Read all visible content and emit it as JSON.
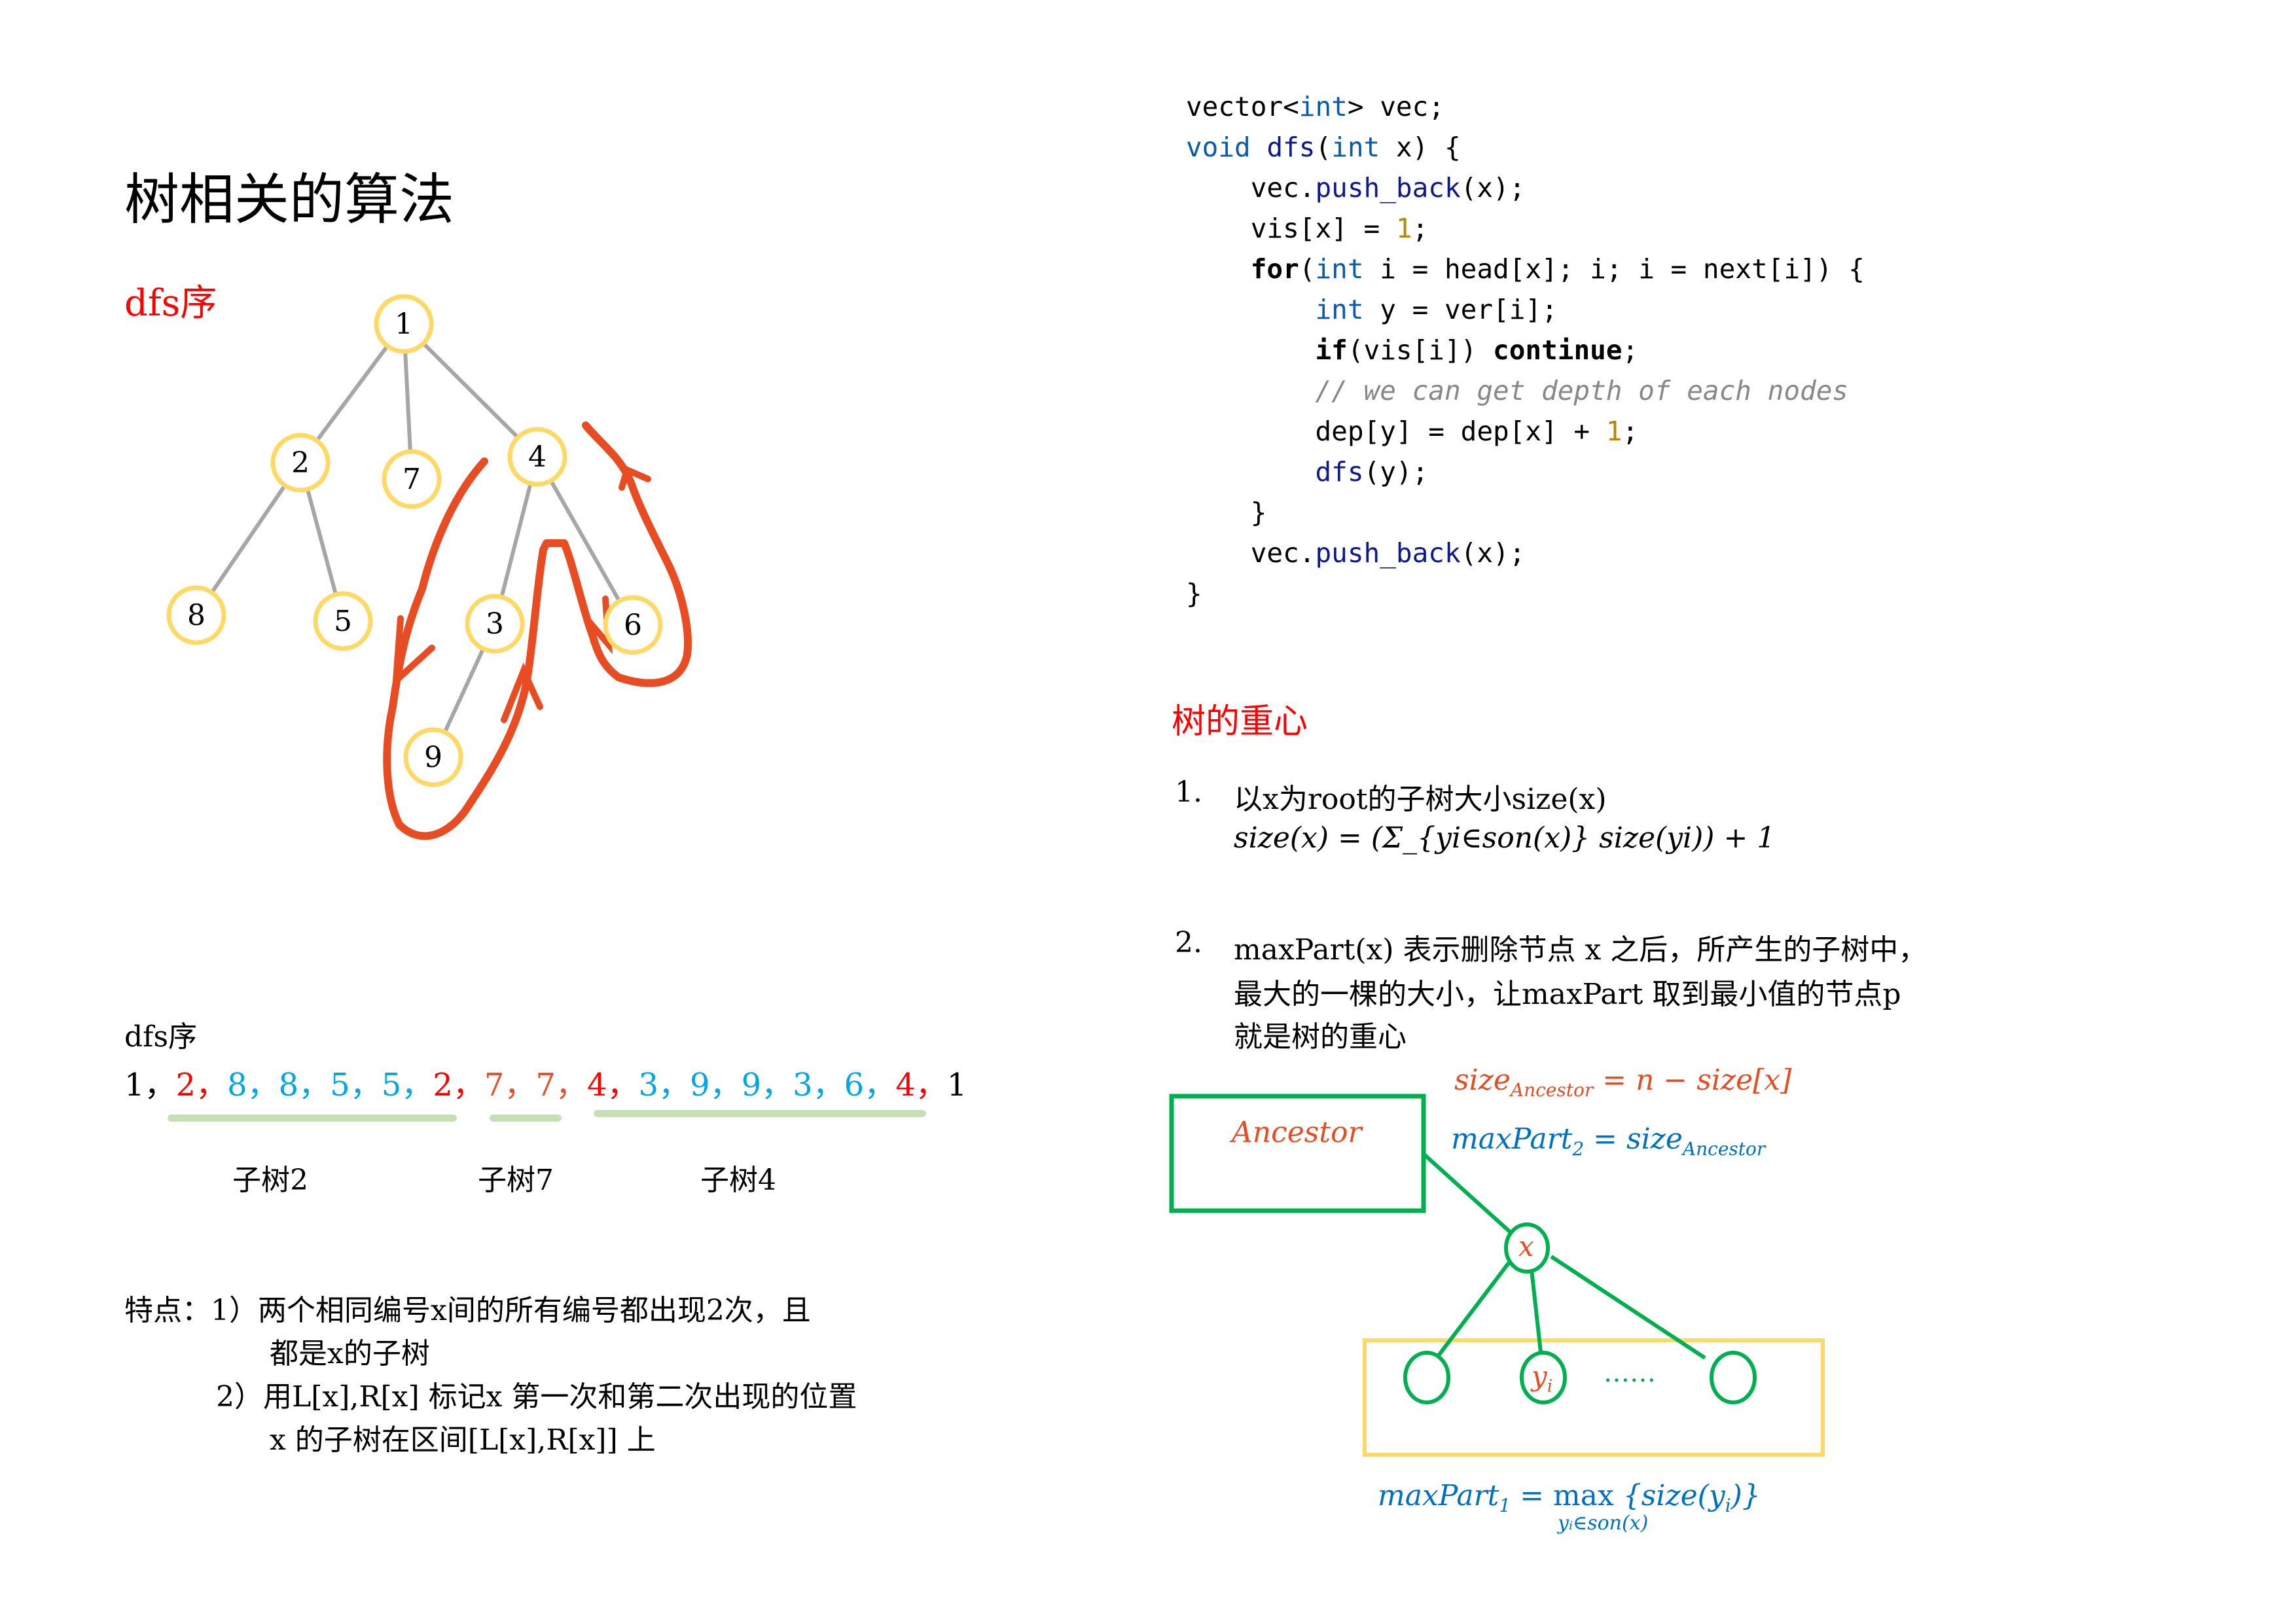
{
  "title": "树相关的算法",
  "dfs_section": {
    "heading": "dfs序",
    "tree": {
      "nodes": [
        {
          "id": "1",
          "label": "1"
        },
        {
          "id": "2",
          "label": "2"
        },
        {
          "id": "7",
          "label": "7"
        },
        {
          "id": "4",
          "label": "4"
        },
        {
          "id": "8",
          "label": "8"
        },
        {
          "id": "5",
          "label": "5"
        },
        {
          "id": "3",
          "label": "3"
        },
        {
          "id": "6",
          "label": "6"
        },
        {
          "id": "9",
          "label": "9"
        }
      ],
      "edges": [
        [
          "1",
          "2"
        ],
        [
          "1",
          "7"
        ],
        [
          "1",
          "4"
        ],
        [
          "2",
          "8"
        ],
        [
          "2",
          "5"
        ],
        [
          "4",
          "3"
        ],
        [
          "4",
          "6"
        ],
        [
          "3",
          "9"
        ]
      ],
      "node_color": "#ffd966",
      "edge_color": "#a6a6a6",
      "annotation_color": "#e84c22"
    },
    "sequence_label": "dfs序",
    "sequence": [
      {
        "v": "1",
        "color": "black"
      },
      {
        "v": "2",
        "color": "red"
      },
      {
        "v": "8",
        "color": "blue"
      },
      {
        "v": "8",
        "color": "blue"
      },
      {
        "v": "5",
        "color": "blue"
      },
      {
        "v": "5",
        "color": "blue"
      },
      {
        "v": "2",
        "color": "red"
      },
      {
        "v": "7",
        "color": "orange"
      },
      {
        "v": "7",
        "color": "orange"
      },
      {
        "v": "4",
        "color": "red"
      },
      {
        "v": "3",
        "color": "blue"
      },
      {
        "v": "9",
        "color": "blue"
      },
      {
        "v": "9",
        "color": "blue"
      },
      {
        "v": "3",
        "color": "blue"
      },
      {
        "v": "6",
        "color": "blue"
      },
      {
        "v": "4",
        "color": "red"
      },
      {
        "v": "1",
        "color": "black"
      }
    ],
    "separator": "，",
    "subtree_labels": [
      "子树2",
      "子树7",
      "子树4"
    ],
    "features": {
      "prefix": "特点：",
      "items": [
        {
          "num": "1）",
          "line1": "两个相同编号x间的所有编号都出现2次，且",
          "line2": "都是x的子树"
        },
        {
          "num": "2）",
          "line1": "用L[x],R[x] 标记x 第一次和第二次出现的位置",
          "line2": "x 的子树在区间[L[x],R[x]] 上"
        }
      ]
    }
  },
  "code": {
    "lines": [
      [
        {
          "t": "vector<",
          "c": ""
        },
        {
          "t": "int",
          "c": "kw"
        },
        {
          "t": "> vec;",
          "c": ""
        }
      ],
      [
        {
          "t": "void",
          "c": "kw"
        },
        {
          "t": " ",
          "c": ""
        },
        {
          "t": "dfs",
          "c": "fn"
        },
        {
          "t": "(",
          "c": ""
        },
        {
          "t": "int",
          "c": "kw"
        },
        {
          "t": " x) {",
          "c": ""
        }
      ],
      [
        {
          "t": "    vec.",
          "c": ""
        },
        {
          "t": "push_back",
          "c": "fn"
        },
        {
          "t": "(x);",
          "c": ""
        }
      ],
      [
        {
          "t": "    vis[x] = ",
          "c": ""
        },
        {
          "t": "1",
          "c": "num"
        },
        {
          "t": ";",
          "c": ""
        }
      ],
      [
        {
          "t": "    ",
          "c": ""
        },
        {
          "t": "for",
          "c": "bold"
        },
        {
          "t": "(",
          "c": ""
        },
        {
          "t": "int",
          "c": "kw"
        },
        {
          "t": " i = head[x]; i; i = next[i]) {",
          "c": ""
        }
      ],
      [
        {
          "t": "        ",
          "c": ""
        },
        {
          "t": "int",
          "c": "kw"
        },
        {
          "t": " y = ver[i];",
          "c": ""
        }
      ],
      [
        {
          "t": "        ",
          "c": ""
        },
        {
          "t": "if",
          "c": "bold"
        },
        {
          "t": "(vis[i]) ",
          "c": ""
        },
        {
          "t": "continue",
          "c": "bold"
        },
        {
          "t": ";",
          "c": ""
        }
      ],
      [
        {
          "t": "        ",
          "c": ""
        },
        {
          "t": "// we can get depth of each nodes",
          "c": "cm"
        }
      ],
      [
        {
          "t": "        dep[y] = dep[x] + ",
          "c": ""
        },
        {
          "t": "1",
          "c": "num"
        },
        {
          "t": ";",
          "c": ""
        }
      ],
      [
        {
          "t": "        ",
          "c": ""
        },
        {
          "t": "dfs",
          "c": "fn"
        },
        {
          "t": "(y);",
          "c": ""
        }
      ],
      [
        {
          "t": "    }",
          "c": ""
        }
      ],
      [
        {
          "t": "    vec.",
          "c": ""
        },
        {
          "t": "push_back",
          "c": "fn"
        },
        {
          "t": "(x);",
          "c": ""
        }
      ],
      [
        {
          "t": "}",
          "c": ""
        }
      ]
    ]
  },
  "centroid_section": {
    "heading": "树的重心",
    "item1": {
      "num": "1.",
      "line1": "以x为root的子树大小size(x)",
      "formula": "size(x) = (Σ_{yi∈son(x)} size(yi)) + 1"
    },
    "item2": {
      "num": "2.",
      "line1": "maxPart(x) 表示删除节点 x 之后，所产生的子树中，",
      "line2": "最大的一棵的大小，让maxPart 取到最小值的节点p",
      "line3": "就是树的重心"
    },
    "diagram": {
      "ancestor_label": "Ancestor",
      "x_label": "x",
      "yi_label": "y",
      "yi_sub": "i",
      "ellipsis": "……",
      "size_ancestor_formula": {
        "lhs": "size",
        "lhs_sub": "Ancestor",
        "rhs": " = n − size[x]"
      },
      "maxpart2_formula": {
        "lhs": "maxPart",
        "lhs_sub": "2",
        "mid": " = size",
        "rhs_sub": "Ancestor"
      },
      "maxpart1_formula": {
        "lhs": "maxPart",
        "lhs_sub": "1",
        "mid": " =  max ",
        "rhs": "{size(y",
        "rhs_sub": "i",
        "rhs_end": ")}",
        "under": "yᵢ∈son(x)"
      },
      "colors": {
        "green": "#00b050",
        "yellow": "#ffd966",
        "orange": "#e84c22",
        "blue": "#0070c0"
      }
    }
  }
}
